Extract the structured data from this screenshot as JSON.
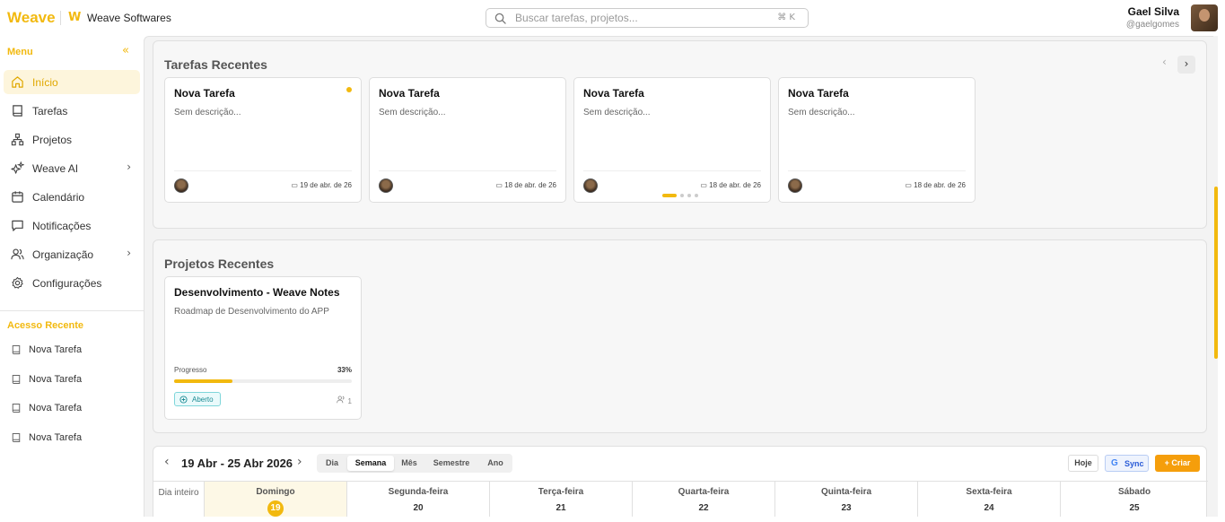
{
  "header": {
    "brand": "Weave",
    "org_logo": "W",
    "org_name": "Weave Softwares",
    "search_placeholder": "Buscar tarefas, projetos...",
    "search_shortcut": "⌘ K",
    "user_name": "Gael Silva",
    "user_handle": "@gaelgomes"
  },
  "sidebar": {
    "menu_title": "Menu",
    "collapse_icon": "«",
    "items": [
      {
        "label": "Início",
        "icon": "home-icon",
        "active": true
      },
      {
        "label": "Tarefas",
        "icon": "book-icon"
      },
      {
        "label": "Projetos",
        "icon": "hierarchy-icon"
      },
      {
        "label": "Weave AI",
        "icon": "sparkles-icon",
        "chevron": "›"
      },
      {
        "label": "Calendário",
        "icon": "calendar-icon"
      },
      {
        "label": "Notificações",
        "icon": "message-icon"
      },
      {
        "label": "Organização",
        "icon": "users-icon",
        "chevron": "›"
      },
      {
        "label": "Configurações",
        "icon": "gear-icon"
      }
    ],
    "recent_title": "Acesso Recente",
    "recent": [
      {
        "label": "Nova Tarefa",
        "icon": "book-icon"
      },
      {
        "label": "Nova Tarefa",
        "icon": "book-icon"
      },
      {
        "label": "Nova Tarefa",
        "icon": "book-icon"
      },
      {
        "label": "Nova Tarefa",
        "icon": "book-icon"
      }
    ]
  },
  "recent_tasks": {
    "title": "Tarefas Recentes",
    "prev_icon": "‹",
    "next_icon": "›",
    "cards": [
      {
        "title": "Nova Tarefa",
        "description": "Sem descrição...",
        "date": "19 de abr. de 26",
        "unread": true
      },
      {
        "title": "Nova Tarefa",
        "description": "Sem descrição...",
        "date": "18 de abr. de 26"
      },
      {
        "title": "Nova Tarefa",
        "description": "Sem descrição...",
        "date": "18 de abr. de 26"
      },
      {
        "title": "Nova Tarefa",
        "description": "Sem descrição...",
        "date": "18 de abr. de 26"
      }
    ],
    "page_count": 4,
    "active_page": 0
  },
  "recent_projects": {
    "title": "Projetos Recentes",
    "cards": [
      {
        "title": "Desenvolvimento - Weave Notes",
        "description": "Roadmap de Desenvolvimento do APP",
        "progress_label": "Progresso",
        "progress_text": "33%",
        "progress": 0.33,
        "status": "Aberto",
        "members": "1"
      }
    ]
  },
  "calendar": {
    "prev_icon": "‹",
    "next_icon": "›",
    "range": "19 Abr - 25 Abr 2026",
    "views": [
      {
        "label": "Dia"
      },
      {
        "label": "Semana",
        "active": true
      },
      {
        "label": "Mês"
      },
      {
        "label": "Semestre"
      },
      {
        "label": "Ano"
      }
    ],
    "today_label": "Hoje",
    "sync_logo": "G",
    "sync_label": "Sync",
    "create_label": "+ Criar",
    "all_day_label": "Dia inteiro",
    "days": [
      {
        "name": "Domingo",
        "number": "19",
        "today": true
      },
      {
        "name": "Segunda-feira",
        "number": "20"
      },
      {
        "name": "Terça-feira",
        "number": "21"
      },
      {
        "name": "Quarta-feira",
        "number": "22"
      },
      {
        "name": "Quinta-feira",
        "number": "23"
      },
      {
        "name": "Sexta-feira",
        "number": "24"
      },
      {
        "name": "Sábado",
        "number": "25"
      }
    ]
  },
  "colors": {
    "accent": "#f2b90f",
    "create_button": "#f59e0b",
    "status_open": "#1a8a93"
  }
}
